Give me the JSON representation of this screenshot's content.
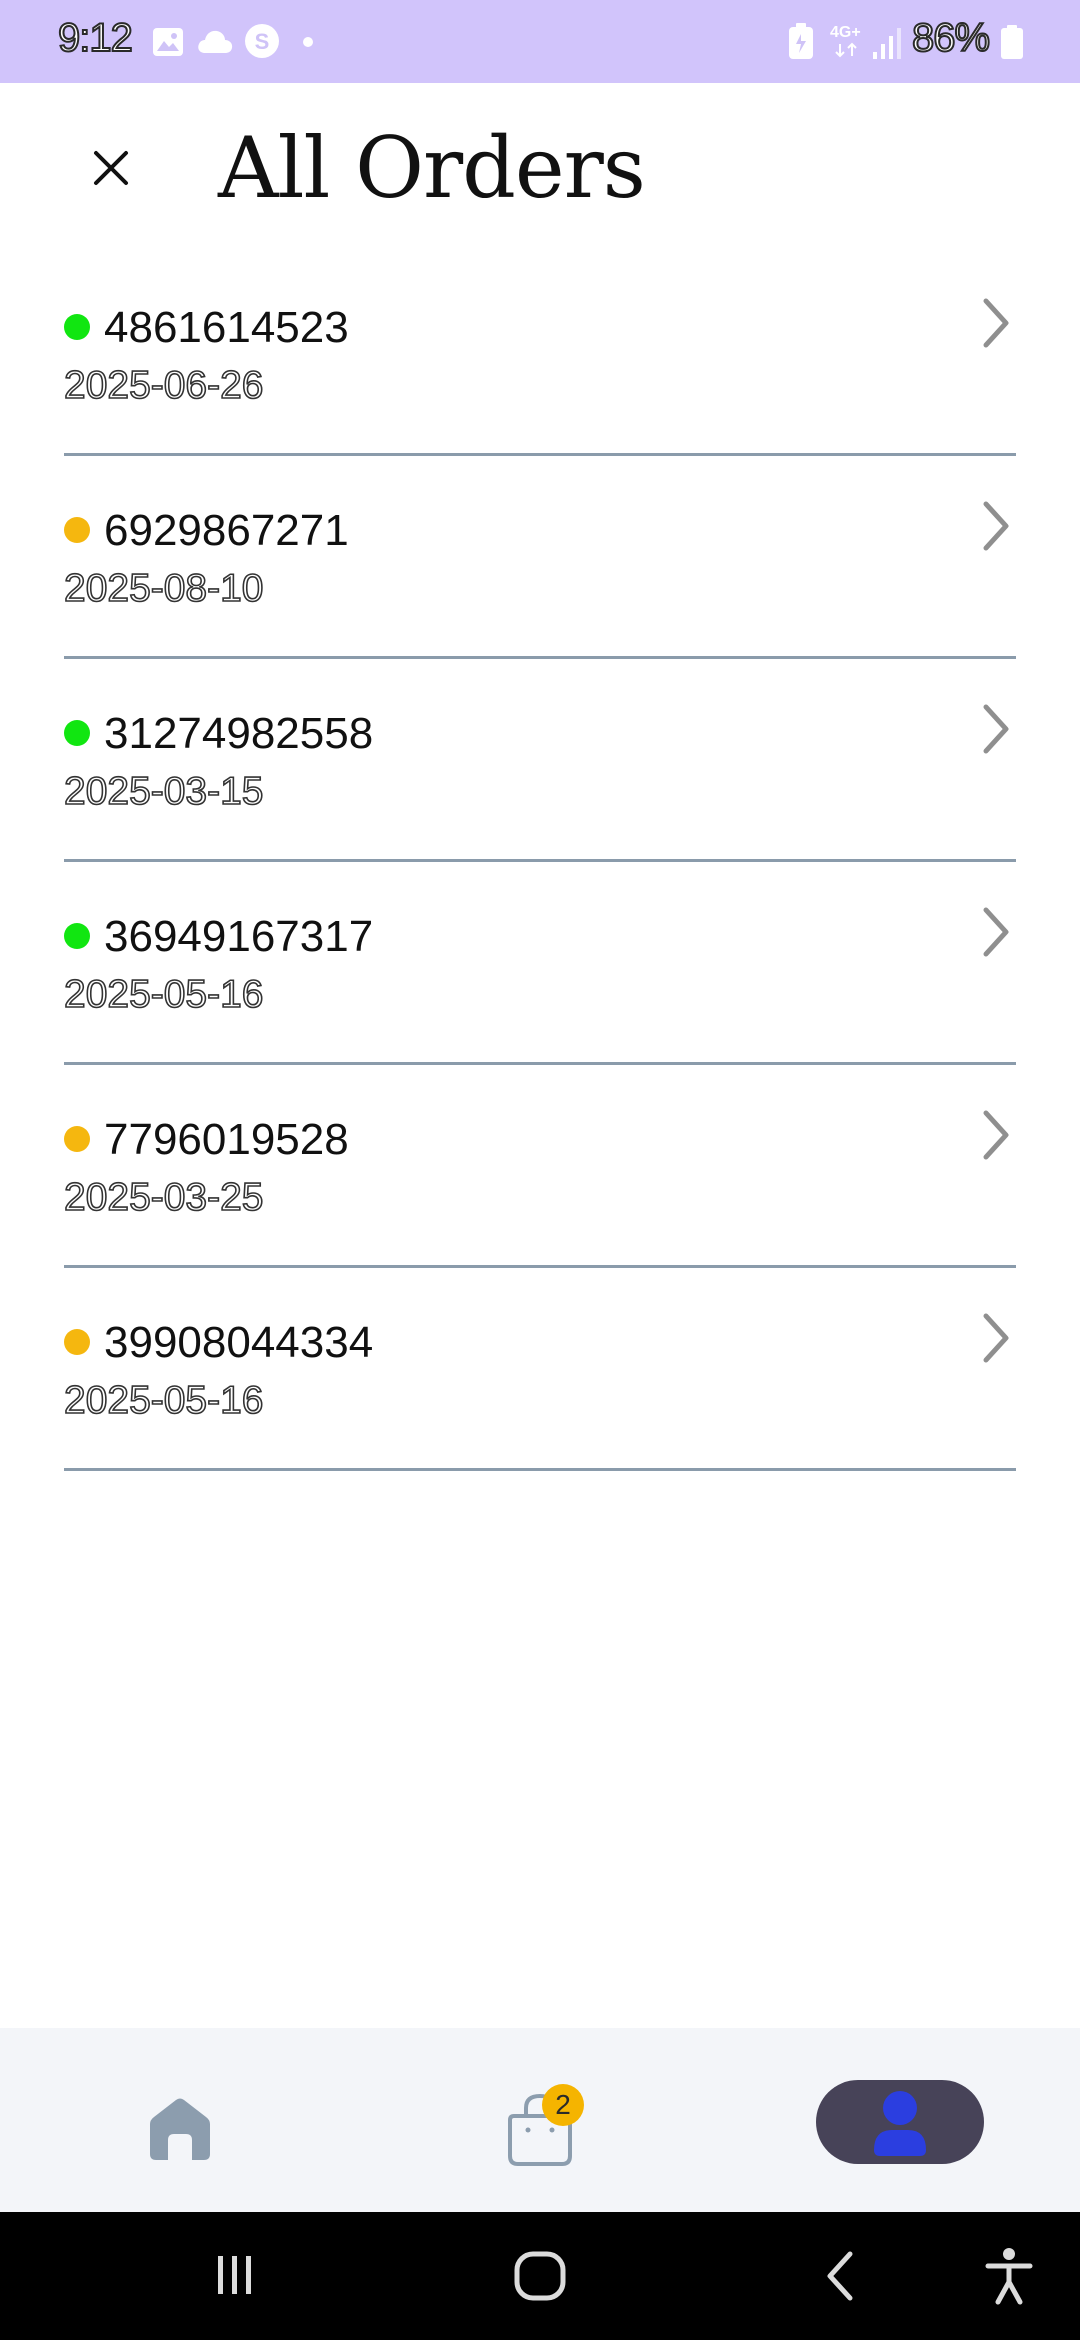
{
  "status_bar": {
    "time": "9:12",
    "battery": "86%",
    "network": "4G+",
    "icons": [
      "gallery-icon",
      "cloud-icon",
      "s-app-icon",
      "dot-icon",
      "battery-saver-icon",
      "signal-icon",
      "battery-icon"
    ]
  },
  "header": {
    "title": "All Orders",
    "close_icon": "close-icon"
  },
  "orders": [
    {
      "id": "4861614523",
      "date": "2025-06-26",
      "status_color": "#11e611"
    },
    {
      "id": "6929867271",
      "date": "2025-08-10",
      "status_color": "#f5b70f"
    },
    {
      "id": "31274982558",
      "date": "2025-03-15",
      "status_color": "#11e611"
    },
    {
      "id": "36949167317",
      "date": "2025-05-16",
      "status_color": "#11e611"
    },
    {
      "id": "7796019528",
      "date": "2025-03-25",
      "status_color": "#f5b70f"
    },
    {
      "id": "39908044334",
      "date": "2025-05-16",
      "status_color": "#f5b70f"
    }
  ],
  "bottom_nav": {
    "items": [
      {
        "icon": "home-icon",
        "active": false
      },
      {
        "icon": "shopping-bag-icon",
        "active": false
      },
      {
        "icon": "profile-icon",
        "active": true
      }
    ],
    "cart_badge": "2"
  },
  "colors": {
    "status_bar_bg": "#d1c4fb",
    "divider": "#8a9bab",
    "nav_active_bg": "#474358",
    "nav_active_icon": "#2b3ee0",
    "nav_inactive_icon": "#8c9dae",
    "badge_bg": "#f5b400"
  }
}
